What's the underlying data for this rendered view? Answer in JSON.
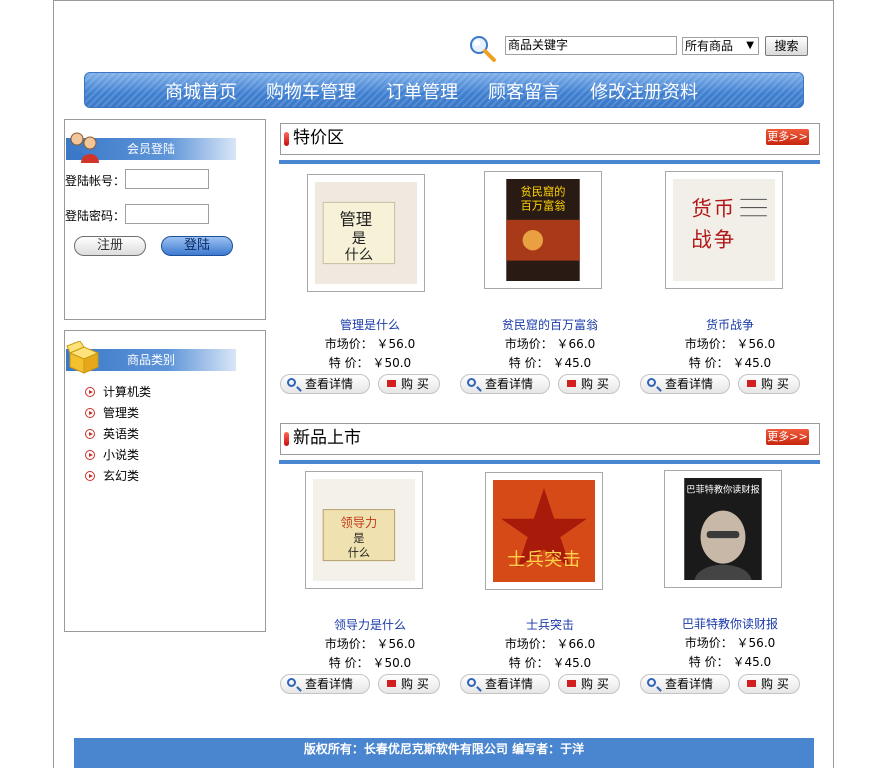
{
  "search": {
    "value": "商品关键字",
    "scope": "所有商品",
    "button": "搜索"
  },
  "nav": [
    "商城首页",
    "购物车管理",
    "订单管理",
    "顾客留言",
    "修改注册资料"
  ],
  "login": {
    "title": "会员登陆",
    "account_label": "登陆帐号：",
    "password_label": "登陆密码：",
    "register": "注册",
    "login": "登陆"
  },
  "categories": {
    "title": "商品类别",
    "items": [
      "计算机类",
      "管理类",
      "英语类",
      "小说类",
      "玄幻类"
    ]
  },
  "common": {
    "market_price_label": "市场价：",
    "special_price_label": "特  价：",
    "detail_button": "查看详情",
    "buy_button": "购 买",
    "more_button": "更多>>"
  },
  "special": {
    "title": "特价区",
    "products": [
      {
        "name": "管理是什么",
        "market": "￥56.0",
        "price": "￥50.0",
        "cover_title": "管理是什么"
      },
      {
        "name": "贫民窟的百万富翁",
        "market": "￥66.0",
        "price": "￥45.0",
        "cover_title": "贫民窟的百万富翁"
      },
      {
        "name": "货币战争",
        "market": "￥56.0",
        "price": "￥45.0",
        "cover_title": "货币战争"
      }
    ]
  },
  "new": {
    "title": "新品上市",
    "products": [
      {
        "name": "领导力是什么",
        "market": "￥56.0",
        "price": "￥50.0",
        "cover_title": "领导力是什么"
      },
      {
        "name": "士兵突击",
        "market": "￥66.0",
        "price": "￥45.0",
        "cover_title": "士兵突击"
      },
      {
        "name": "巴菲特教你读财报",
        "market": "￥56.0",
        "price": "￥45.0",
        "cover_title": "巴菲特教你读财报"
      }
    ]
  },
  "footer": "版权所有：长春优尼克斯软件有限公司 编写者：于洋"
}
